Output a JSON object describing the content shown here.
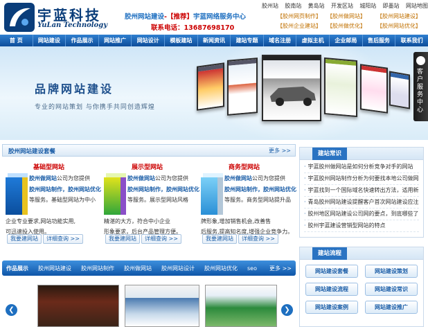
{
  "header": {
    "logo_cn": "宇蓝科技",
    "logo_en": "YuLan Technology",
    "slogan_a": "胶州网站建设",
    "slogan_b": "-【推荐】",
    "slogan_c": "宇蓝网络服务中心",
    "contact": "联系电话：13687698170",
    "top_links": [
      "胶州站",
      "胶南站",
      "黄岛站",
      "开发区站",
      "城阳站",
      "即墨站",
      "网站地图"
    ],
    "services": [
      "【胶州网页制作】",
      "【胶州做网站】",
      "【胶州网站建设】",
      "【胶州企业建站】",
      "【胶州做优化】",
      "【胶州网站优化】"
    ]
  },
  "nav": [
    "首 页",
    "网站建设",
    "作品展示",
    "网站推广",
    "网站设计",
    "模板建站",
    "新闻资讯",
    "建站专题",
    "域名注册",
    "虚拟主机",
    "企业邮局",
    "售后服务",
    "联系我们"
  ],
  "banner": {
    "title": "品牌网站建设",
    "subtitle": "专业的网站策划  与你携手共同创造辉煌"
  },
  "side_tab": {
    "label": "客户服务中心"
  },
  "packages": {
    "title": "胶州网站建设套餐",
    "more": "更多 >>",
    "items": [
      {
        "title": "基础型网站",
        "desc_hl": "胶州做网站",
        "desc_a": "公司为您提供",
        "desc_b": "胶州网站制作，",
        "desc_c": "胶州网站优化",
        "desc_d": "等服务。基础型网站为中小",
        "desc_e": "企业专业要求,网站功能实用,",
        "desc_f": "可迅速投入使用。",
        "btn_a": "我要建网站",
        "btn_b": "详细查询 >>"
      },
      {
        "title": "展示型网站",
        "desc_hl": "胶州做网站",
        "desc_a": "公司为您提供",
        "desc_b": "胶州网站制作，",
        "desc_c": "胶州网站优化",
        "desc_d": "等服务。展示型网站风格",
        "desc_e": "精湛的大方，符合中小企业",
        "desc_f": "形象要求，后台产品管理方便。",
        "btn_a": "我要建网站",
        "btn_b": "详细查询 >>"
      },
      {
        "title": "商务型网站",
        "desc_hl": "胶州做网站",
        "desc_a": "公司为您提供",
        "desc_b": "胶州网站制作，",
        "desc_c": "胶州网站优化",
        "desc_d": "等服务。商务型网站提升品",
        "desc_e": "牌形象,增加销售机会,改善售",
        "desc_f": "后服务,提高知名度,增强企业竞争力。",
        "btn_a": "我要建网站",
        "btn_b": "详细查询 >>"
      }
    ]
  },
  "knowledge": {
    "title": "建站常识",
    "items": [
      "宇蓝胶州做网站是如何分析竞争对手的网站",
      "宇蓝胶州网站制作分析为何要找本地公司做网站",
      "宇蓝找到一个国际域名快速转出方法，适用新",
      "青岛胶州网站建设提醒客户首次网站建设应注意",
      "胶州地区网站建设公司网的要点，到底哪些了",
      "胶州宇蓝建设营销型网站的特点"
    ]
  },
  "flow": {
    "title": "建站流程",
    "buttons": [
      "网站建设套餐",
      "网站建设策划",
      "网站建设流程",
      "网站建设常识",
      "网站建设案例",
      "网站建设推广"
    ]
  },
  "works": {
    "tabs": [
      "作品展示",
      "胶州网站建设",
      "胶州网站制作",
      "胶州做网站",
      "胶州网站设计",
      "胶州网站优化",
      "seo"
    ],
    "more": "更多 >>"
  },
  "colors": {
    "nav_blue": "#0d4d9a",
    "accent_red": "#cc0000",
    "link_blue": "#1d5fa8"
  }
}
